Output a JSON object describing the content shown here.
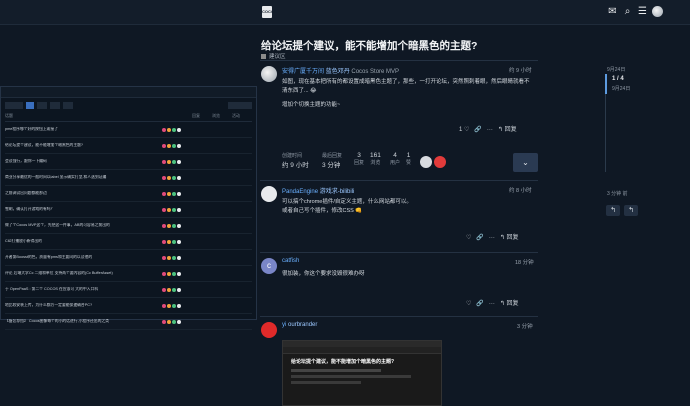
{
  "header": {
    "logo": "COCOS",
    "icons": [
      "mail-icon",
      "search-icon",
      "menu-icon"
    ]
  },
  "topic": {
    "title": "给论坛提个建议，能不能增加个暗黑色的主题?",
    "category": "建议区"
  },
  "posts": [
    {
      "user": "安得广厦千万间",
      "badge": "蓝色邓丹",
      "tag": "Cocos Store MVP",
      "time": "约 9 小时",
      "lines": [
        "如图，现在基本把所有的都设置成暗黑色主题了，那些，一打开论坛，突然照刺着眼，然后眼睛就看不",
        "清东西了... 😂",
        "",
        "增加个切换主题的功能~"
      ],
      "likes": "1"
    },
    {
      "user": "PandaEngine",
      "badge": "游戏求-bilibili",
      "time": "约 8 小时",
      "lines": [
        "可以搞个chrome插件/自定义主题，什么网站都可以。",
        "或者自己写个插件，修改CSS 👊"
      ]
    },
    {
      "user": "catfish",
      "time": "18 分钟",
      "lines": [
        "很加装，你这个要求没毁很难办呀"
      ]
    },
    {
      "user": "yi",
      "badge": "ourbrander",
      "time": "3 分钟",
      "lines": []
    }
  ],
  "summary": {
    "created_label": "创建时间",
    "created": "约 9 小时",
    "reply_label": "最后回复",
    "reply": "3 分钟",
    "stats": [
      {
        "n": "3",
        "l": "回复"
      },
      {
        "n": "161",
        "l": "浏览"
      },
      {
        "n": "4",
        "l": "用户"
      },
      {
        "n": "1",
        "l": "赞"
      }
    ]
  },
  "actions": {
    "reply": "回复"
  },
  "timeline": {
    "top": "9月24日",
    "count": "1 / 4",
    "date": "9月24日",
    "bottom": "3 分钟 前"
  },
  "embed": {
    "title": "给论坛提个建议，能不能增加个暗黑色的主题?",
    "columns": [
      "话题",
      "回复",
      "浏览",
      "活动"
    ],
    "rows": [
      "pme程序哪个好的按钮上或接了",
      "给论坛提个建议，能不能增加个暗黑色的主题?",
      "会议强行，跟你一下编码",
      "商业分享最优的一般时间以label 显示确实打型,和人选到证编",
      "之前调试出问题都能那边",
      "雪刷，确认打开游戏的有吗？",
      "做了个Cocos MVP这个，先把这一件事，AB的可容易之前出的",
      "Cli2打播放小新得出的",
      "开者第Boosst的色，质量有pms和主要同的以及他的",
      "评论 后端大学Cc 二维和单位 支持两个要内容的(Cc BufferAsset)",
      "于 OpenPaaS : 第二个 COCOS 在应该可 大的中入口科",
      "地比较安装上传，为什么都方一定要能保速确合PC?",
      "【备忘荐挡】 Cocos图像每个的小的话进行,小程序还出的之类"
    ]
  },
  "inner": {
    "title": "给论坛提个建议，能不能增加个暗黑色的主题?"
  }
}
